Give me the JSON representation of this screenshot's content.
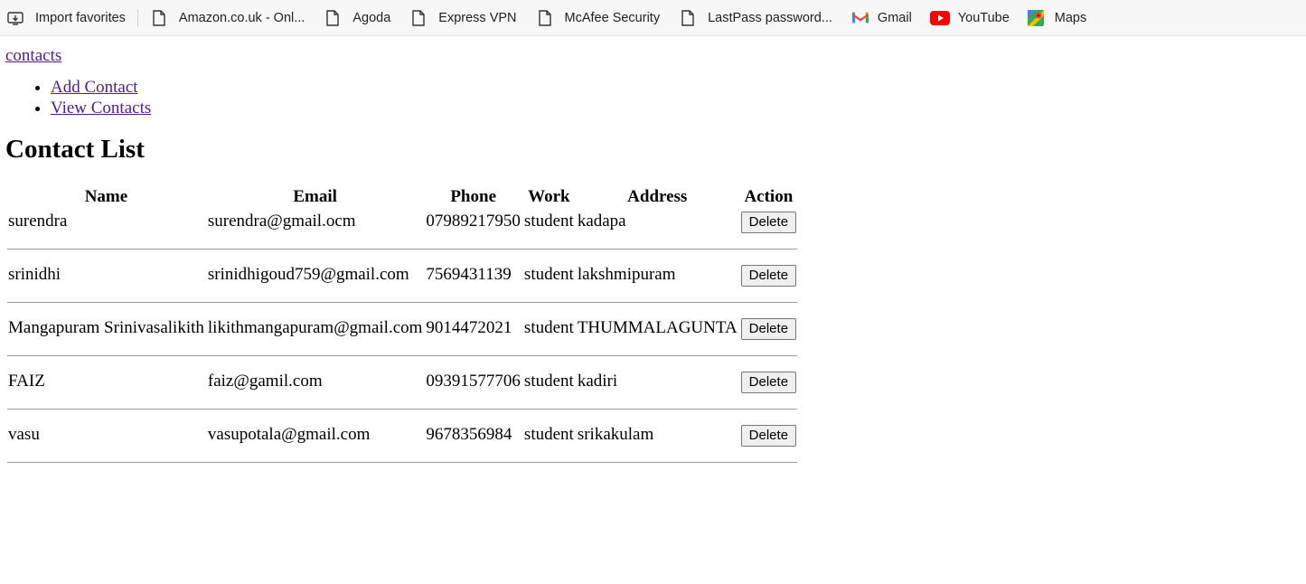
{
  "favorites": [
    {
      "label": "Import favorites",
      "icon": "import-icon"
    },
    {
      "label": "Amazon.co.uk - Onl...",
      "icon": "page-icon"
    },
    {
      "label": "Agoda",
      "icon": "page-icon"
    },
    {
      "label": "Express VPN",
      "icon": "page-icon"
    },
    {
      "label": "McAfee Security",
      "icon": "page-icon"
    },
    {
      "label": "LastPass password...",
      "icon": "page-icon"
    },
    {
      "label": "Gmail",
      "icon": "gmail-icon"
    },
    {
      "label": "YouTube",
      "icon": "youtube-icon"
    },
    {
      "label": "Maps",
      "icon": "maps-icon"
    }
  ],
  "brand": "contacts",
  "nav": [
    "Add Contact",
    "View Contacts"
  ],
  "title": "Contact List",
  "table": {
    "headers": [
      "Name",
      "Email",
      "Phone",
      "Work",
      "Address",
      "Action"
    ],
    "rows": [
      {
        "name": "surendra",
        "email": "surendra@gmail.ocm",
        "phone": "07989217950",
        "work": "student",
        "address": "kadapa",
        "action": "Delete"
      },
      {
        "name": "srinidhi",
        "email": "srinidhigoud759@gmail.com",
        "phone": "7569431139",
        "work": "student",
        "address": "lakshmipuram",
        "action": "Delete"
      },
      {
        "name": "Mangapuram Srinivasalikith",
        "email": "likithmangapuram@gmail.com",
        "phone": "9014472021",
        "work": "student",
        "address": "THUMMALAGUNTA",
        "action": "Delete"
      },
      {
        "name": "FAIZ",
        "email": "faiz@gamil.com",
        "phone": "09391577706",
        "work": "student",
        "address": "kadiri",
        "action": "Delete"
      },
      {
        "name": "vasu",
        "email": "vasupotala@gmail.com",
        "phone": "9678356984",
        "work": "student",
        "address": "srikakulam",
        "action": "Delete"
      }
    ]
  },
  "colors": {
    "link": "#551a8b",
    "favbar_bg": "#f7f7f7",
    "divider": "#9a9a9a"
  }
}
